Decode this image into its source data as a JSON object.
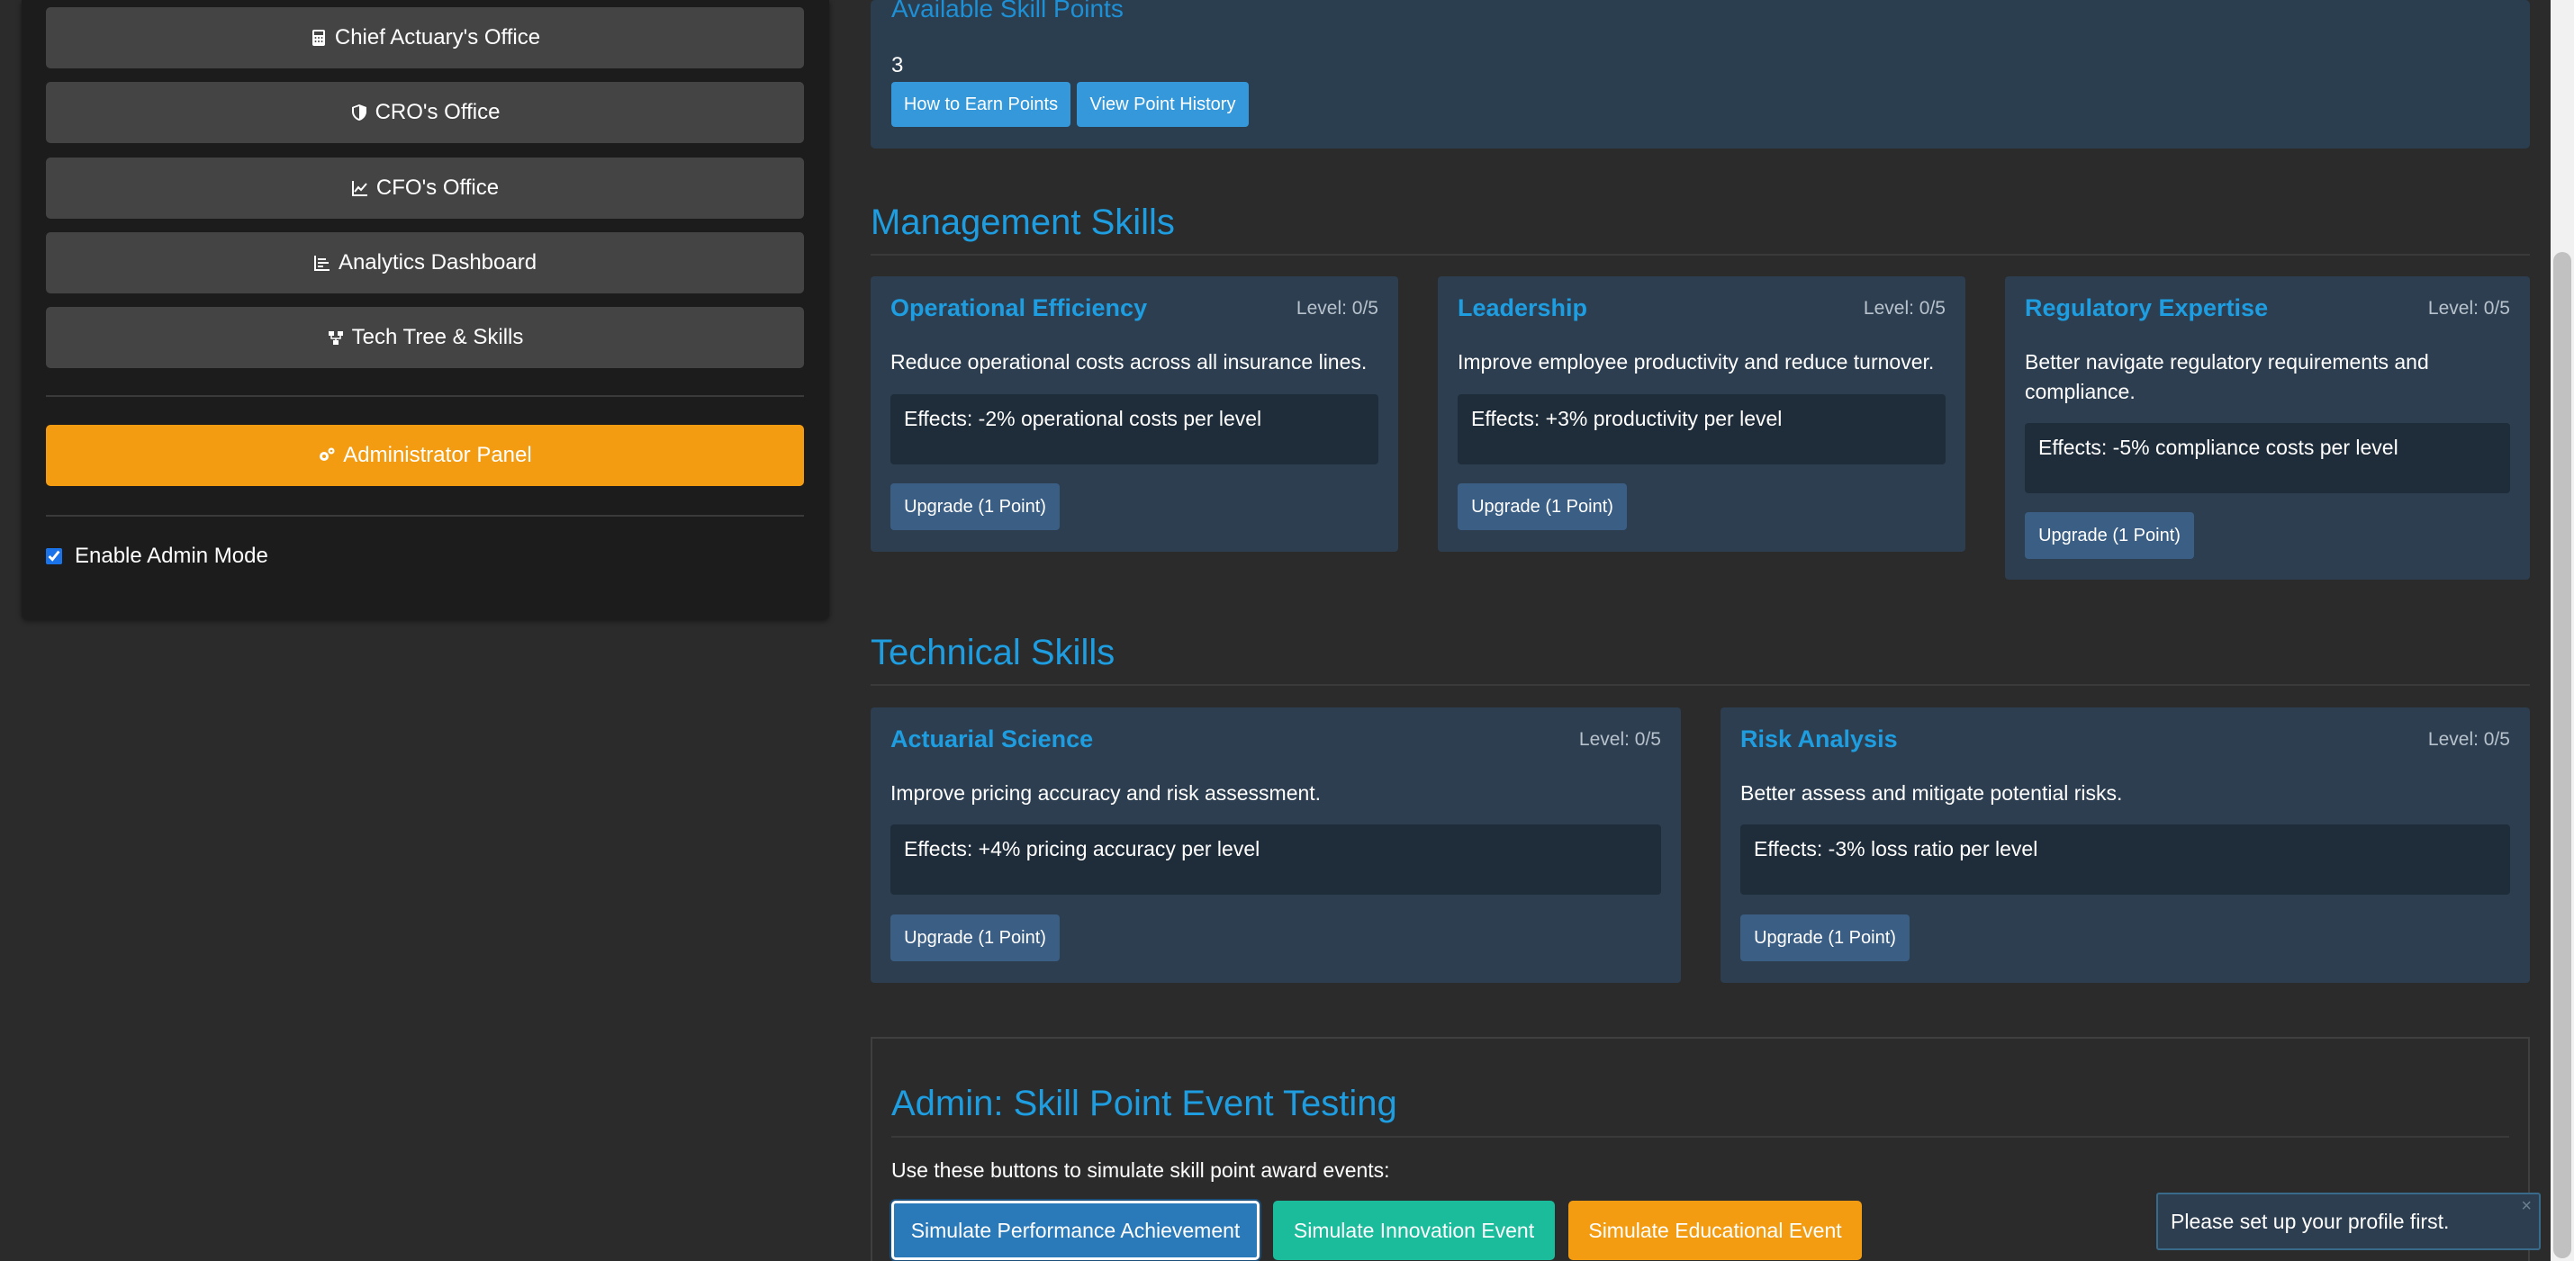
{
  "sidebar": {
    "nav": [
      {
        "label": "Chief Actuary's Office",
        "icon": "calculator-icon"
      },
      {
        "label": "CRO's Office",
        "icon": "shield-icon"
      },
      {
        "label": "CFO's Office",
        "icon": "line-chart-icon"
      },
      {
        "label": "Analytics Dashboard",
        "icon": "bar-chart-icon"
      },
      {
        "label": "Tech Tree & Skills",
        "icon": "sitemap-icon"
      }
    ],
    "admin_panel_label": "Administrator Panel",
    "admin_mode_label": "Enable Admin Mode",
    "admin_mode_checked": true
  },
  "points": {
    "title": "Available Skill Points",
    "value": "3",
    "earn_label": "How to Earn Points",
    "history_label": "View Point History"
  },
  "management": {
    "title": "Management Skills",
    "skills": [
      {
        "name": "Operational Efficiency",
        "level": "Level: 0/5",
        "desc": "Reduce operational costs across all insurance lines.",
        "effects": "Effects: -2% operational costs per level",
        "upgrade": "Upgrade (1 Point)"
      },
      {
        "name": "Leadership",
        "level": "Level: 0/5",
        "desc": "Improve employee productivity and reduce turnover.",
        "effects": "Effects: +3% productivity per level",
        "upgrade": "Upgrade (1 Point)"
      },
      {
        "name": "Regulatory Expertise",
        "level": "Level: 0/5",
        "desc": "Better navigate regulatory requirements and compliance.",
        "effects": "Effects: -5% compliance costs per level",
        "upgrade": "Upgrade (1 Point)"
      }
    ]
  },
  "technical": {
    "title": "Technical Skills",
    "skills": [
      {
        "name": "Actuarial Science",
        "level": "Level: 0/5",
        "desc": "Improve pricing accuracy and risk assessment.",
        "effects": "Effects: +4% pricing accuracy per level",
        "upgrade": "Upgrade (1 Point)"
      },
      {
        "name": "Risk Analysis",
        "level": "Level: 0/5",
        "desc": "Better assess and mitigate potential risks.",
        "effects": "Effects: -3% loss ratio per level",
        "upgrade": "Upgrade (1 Point)"
      }
    ]
  },
  "admin": {
    "title": "Admin: Skill Point Event Testing",
    "desc": "Use these buttons to simulate skill point award events:",
    "buttons": [
      {
        "label": "Simulate Performance Achievement",
        "color": "#2a7ab9"
      },
      {
        "label": "Simulate Innovation Event",
        "color": "#1abc9c"
      },
      {
        "label": "Simulate Educational Event",
        "color": "#f39c12"
      }
    ]
  },
  "toast": {
    "message": "Please set up your profile first.",
    "close": "×"
  },
  "colors": {
    "accent": "#1e9de0",
    "admin_orange": "#f39c12",
    "card_bg": "#2c3e50"
  }
}
